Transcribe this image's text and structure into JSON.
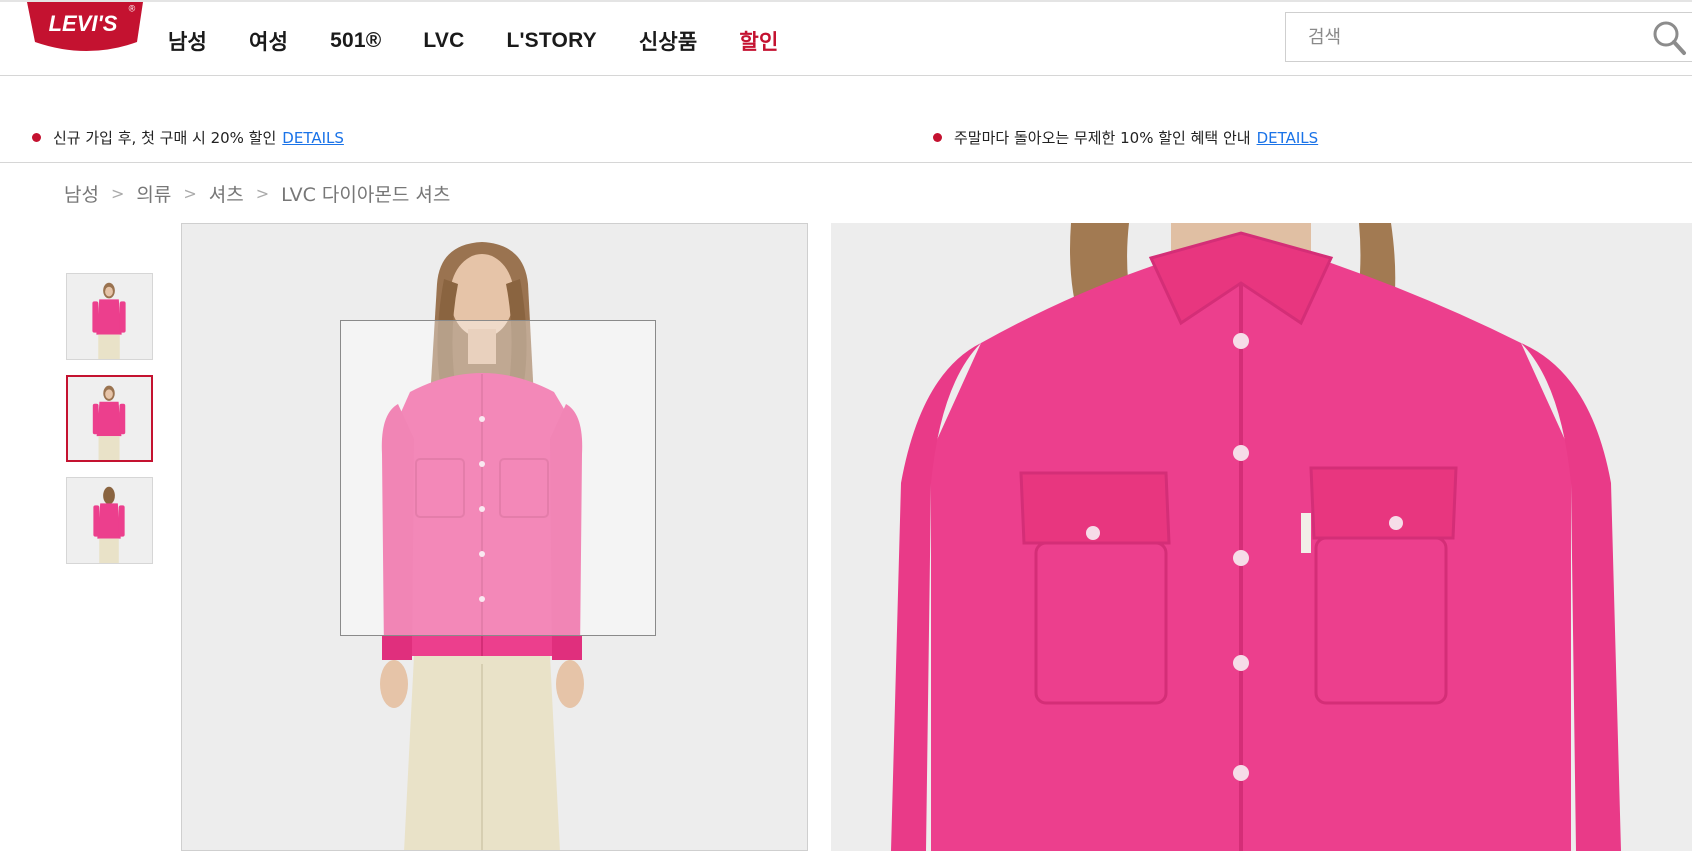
{
  "brand": {
    "logo_text": "LEVI'S",
    "registered_mark": "®",
    "logo_color": "#c41230"
  },
  "nav": {
    "items": [
      {
        "label": "남성"
      },
      {
        "label": "여성"
      },
      {
        "label": "501®"
      },
      {
        "label": "LVC"
      },
      {
        "label": "L'STORY"
      },
      {
        "label": "신상품"
      },
      {
        "label": "할인"
      }
    ],
    "sale_color": "#c41230"
  },
  "search": {
    "placeholder": "검색",
    "icon": "search-icon"
  },
  "promos": [
    {
      "text": "신규 가입 후, 첫 구매 시 20% 할인",
      "link": "DETAILS"
    },
    {
      "text": "주말마다 돌아오는 무제한 10% 할인 혜택 안내",
      "link": "DETAILS"
    }
  ],
  "breadcrumb": {
    "items": [
      "남성",
      "의류",
      "셔츠",
      "LVC 다이아몬드 셔츠"
    ],
    "separator": ">"
  },
  "gallery": {
    "thumbnails": [
      {
        "view": "front"
      },
      {
        "view": "front",
        "selected": true
      },
      {
        "view": "back"
      }
    ],
    "accent": "#c41230",
    "shirt_color": "#ec3f8d",
    "pants_color": "#e9e2c8"
  }
}
